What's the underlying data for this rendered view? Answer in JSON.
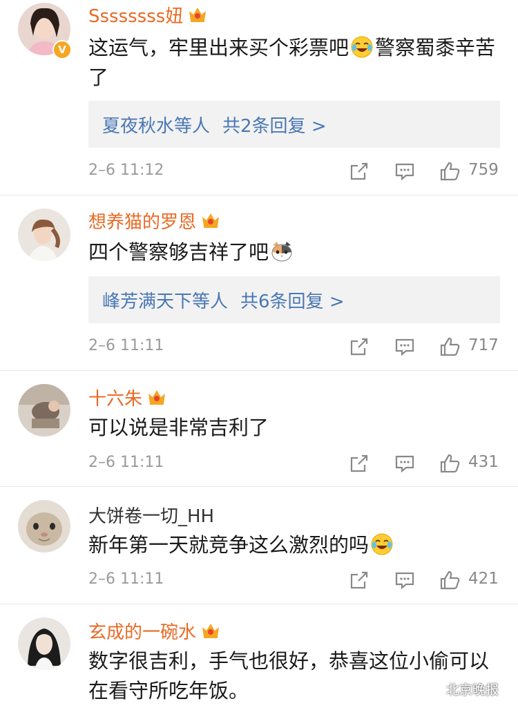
{
  "comments": [
    {
      "username": "Ssssssss妞",
      "text": "这运气，牢里出来买个彩票吧",
      "text_after": "警察蜀黍辛苦了",
      "emoji_icon": "laughing-tears-emoji-icon",
      "reply_users": "夏夜秋水等人",
      "reply_count": "共2条回复 >",
      "time": "2–6 11:12",
      "likes": "759",
      "verified_icon": "verified-v-icon"
    },
    {
      "username": "想养猫的罗恩",
      "text": "四个警察够吉祥了吧",
      "emoji_icon": "cat-face-emoji-icon",
      "reply_users": "峰芳满天下等人",
      "reply_count": "共6条回复 >",
      "time": "2–6 11:11",
      "likes": "717"
    },
    {
      "username": "十六朱",
      "text": "可以说是非常吉利了",
      "time": "2–6 11:11",
      "likes": "431"
    },
    {
      "username": "大饼卷一切_HH",
      "text": "新年第一天就竞争这么激烈的吗",
      "emoji_icon": "laughing-tears-emoji-icon",
      "time": "2–6 11:11",
      "likes": "421"
    },
    {
      "username": "玄成的一碗水",
      "text": "数字很吉利，手气也很好，恭喜这位小偷可以在看守所吃年饭。"
    }
  ],
  "watermark": "北京晚报",
  "colors": {
    "username_orange": "#e86a25",
    "link_blue": "#4a77b5",
    "meta_gray": "#9a9a9a",
    "reply_bg": "#f2f2f2"
  }
}
